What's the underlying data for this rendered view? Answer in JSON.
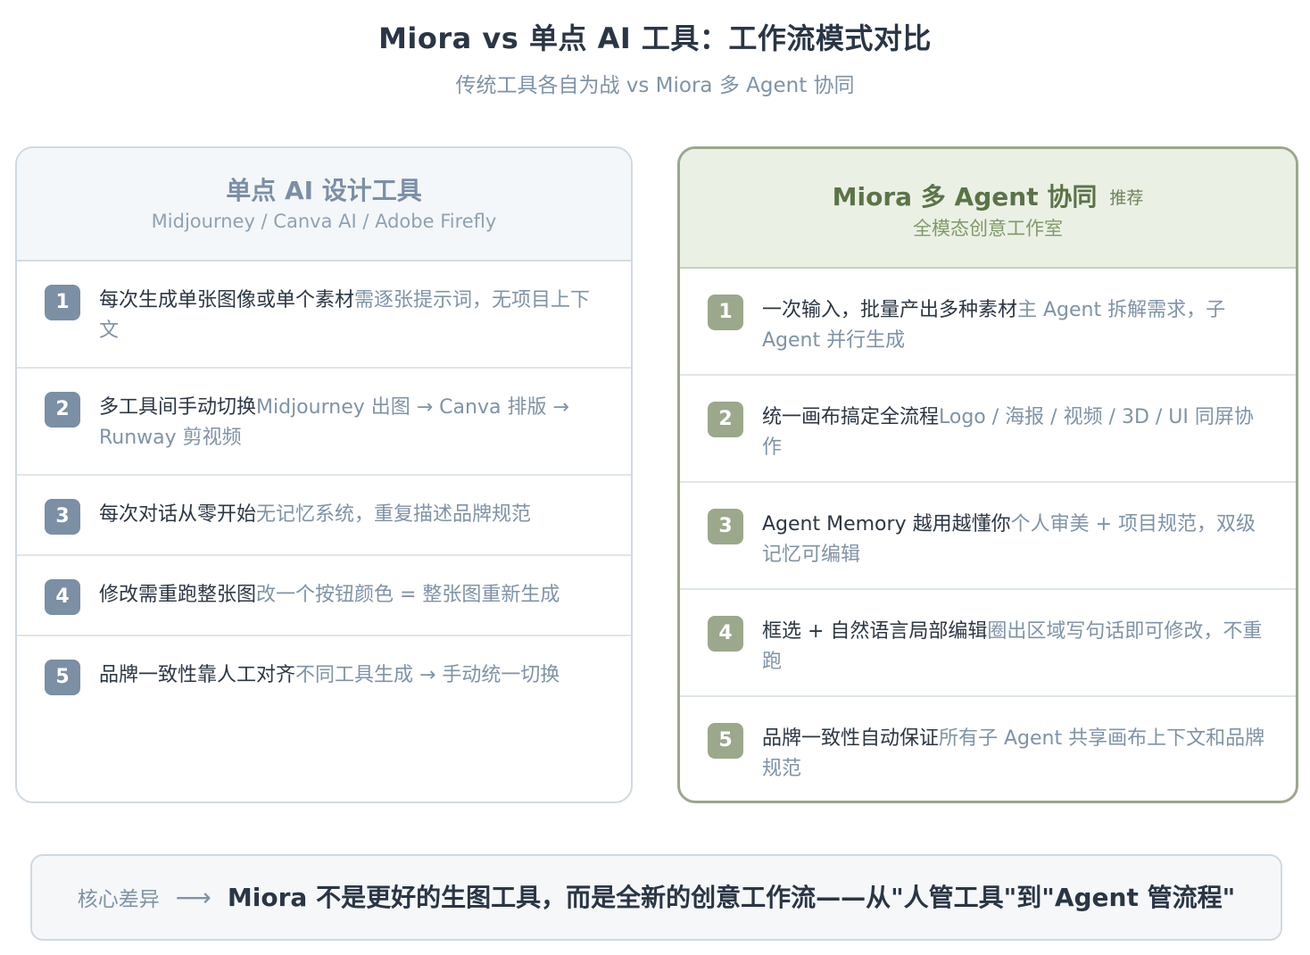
{
  "header": {
    "title": "Miora vs 单点 AI 工具：工作流模式对比",
    "subtitle": "传统工具各自为战 vs Miora 多 Agent 协同"
  },
  "left_card": {
    "title": "单点 AI 设计工具",
    "subtitle": "Midjourney / Canva AI / Adobe Firefly",
    "items": [
      {
        "num": "1",
        "main": "每次生成单张图像或单个素材",
        "sub": "需逐张提示词，无项目上下文"
      },
      {
        "num": "2",
        "main": "多工具间手动切换",
        "sub": "Midjourney 出图 → Canva 排版 → Runway 剪视频"
      },
      {
        "num": "3",
        "main": "每次对话从零开始",
        "sub": "无记忆系统，重复描述品牌规范"
      },
      {
        "num": "4",
        "main": "修改需重跑整张图",
        "sub": "改一个按钮颜色 = 整张图重新生成"
      },
      {
        "num": "5",
        "main": "品牌一致性靠人工对齐",
        "sub": "不同工具生成 → 手动统一切换"
      }
    ]
  },
  "right_card": {
    "title": "Miora 多 Agent 协同",
    "badge": "推荐",
    "subtitle": "全模态创意工作室",
    "items": [
      {
        "num": "1",
        "main": "一次输入，批量产出多种素材",
        "sub": "主 Agent 拆解需求，子 Agent 并行生成"
      },
      {
        "num": "2",
        "main": "统一画布搞定全流程",
        "sub": "Logo / 海报 / 视频 / 3D / UI 同屏协作"
      },
      {
        "num": "3",
        "main": "Agent Memory 越用越懂你",
        "sub": "个人审美 + 项目规范，双级记忆可编辑"
      },
      {
        "num": "4",
        "main": "框选 + 自然语言局部编辑",
        "sub": "圈出区域写句话即可修改，不重跑"
      },
      {
        "num": "5",
        "main": "品牌一致性自动保证",
        "sub": "所有子 Agent 共享画布上下文和品牌规范"
      }
    ]
  },
  "footer": {
    "label": "核心差异",
    "arrow": "⟶",
    "text": "Miora 不是更好的生图工具，而是全新的创意工作流——从\"人管工具\"到\"Agent 管流程\""
  },
  "colors": {
    "left_accent": "#7b8fa5",
    "right_accent": "#9ba88b",
    "right_title": "#5b7447"
  }
}
